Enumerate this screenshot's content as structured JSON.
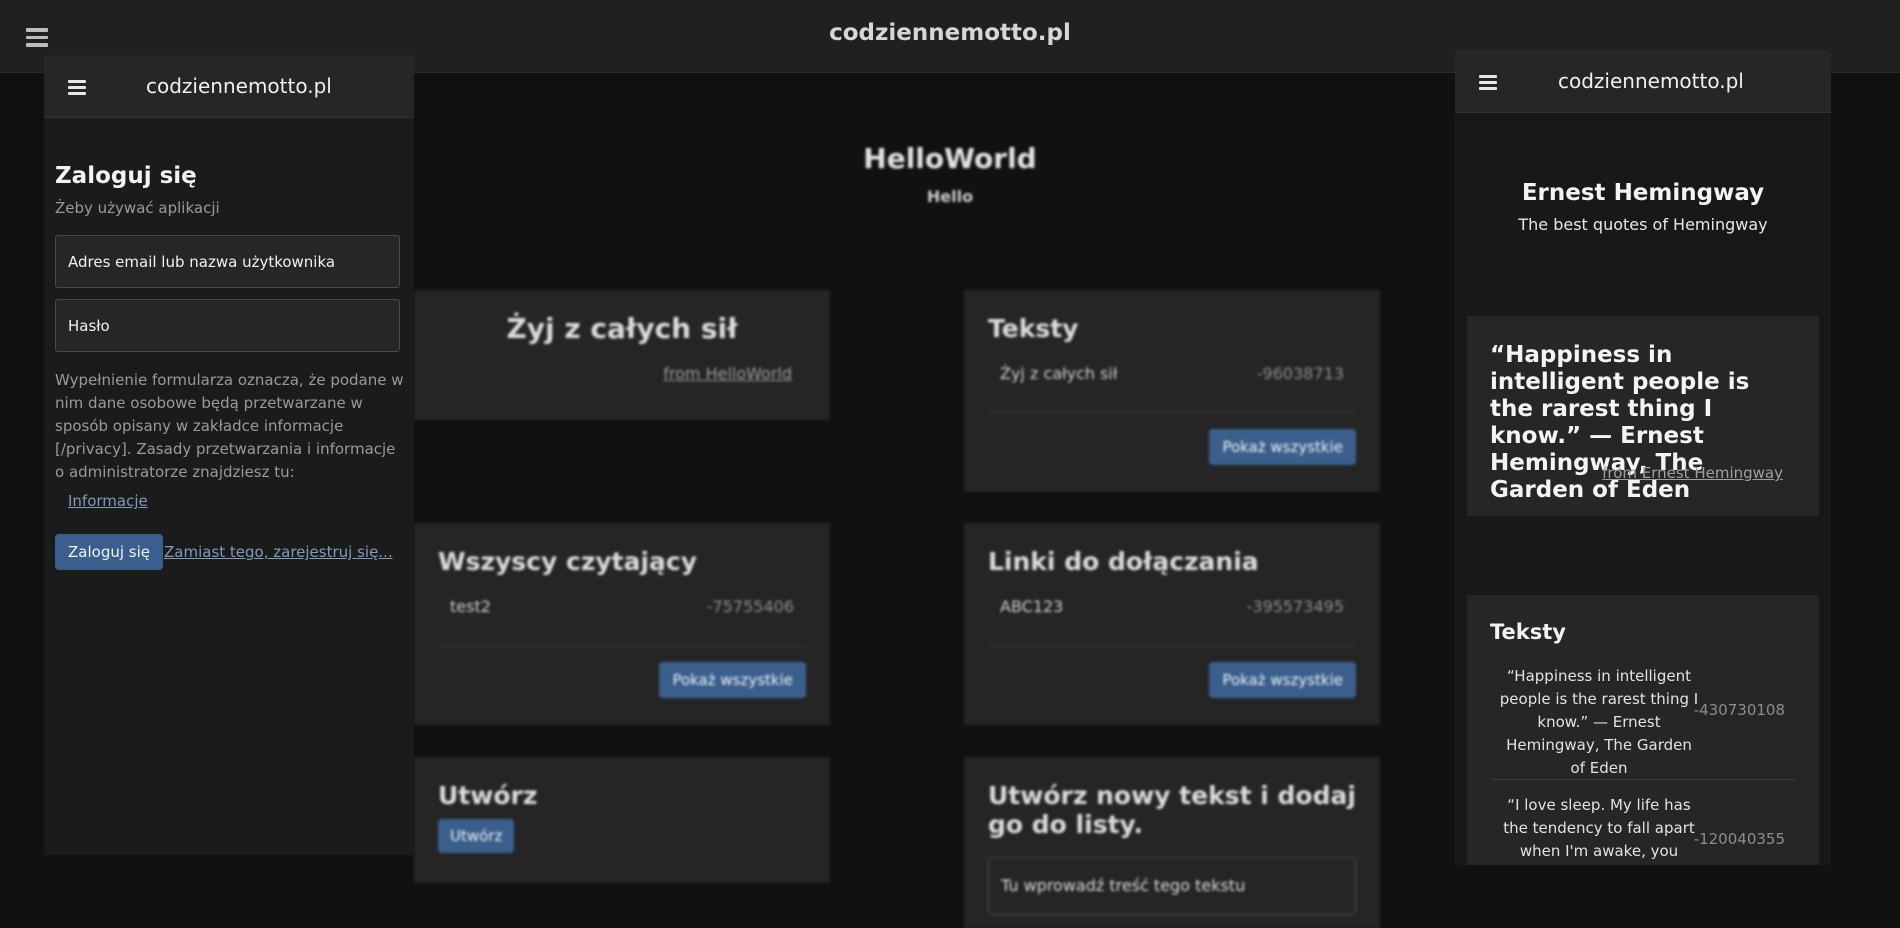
{
  "background": {
    "site_title": "codziennemotto.pl",
    "heading": "HelloWorld",
    "subheading": "Hello",
    "motto_card": {
      "title": "Żyj z całych sił",
      "from_link": "from HelloWorld"
    },
    "texts_card": {
      "title": "Teksty",
      "rows": [
        {
          "name": "Żyj z całych sił",
          "value": "-96038713"
        }
      ],
      "button": "Pokaż wszystkie"
    },
    "readers_card": {
      "title": "Wszyscy czytający",
      "rows": [
        {
          "name": "test2",
          "value": "-75755406"
        }
      ],
      "button": "Pokaż wszystkie"
    },
    "links_card": {
      "title": "Linki do dołączania",
      "rows": [
        {
          "name": "ABC123",
          "value": "-395573495"
        }
      ],
      "button": "Pokaż wszystkie"
    },
    "create_card": {
      "title": "Utwórz",
      "button": "Utwórz"
    },
    "new_text_card": {
      "title": "Utwórz nowy tekst i dodaj go do listy.",
      "placeholder": "Tu wprowadź treść tego tekstu"
    }
  },
  "left_panel": {
    "site_title": "codziennemotto.pl",
    "login_title": "Zaloguj się",
    "login_subtitle": "Żeby używać aplikacji",
    "email_placeholder": "Adres email lub nazwa użytkownika",
    "password_placeholder": "Hasło",
    "consent_text": "Wypełnienie formularza oznacza, że podane w nim dane osobowe będą przetwarzane w sposób opisany w zakładce informacje [/privacy]. Zasady przetwarzania i informacje o administratorze znajdziesz tu:",
    "info_link": "Informacje",
    "login_button": "Zaloguj się",
    "register_link": "Zamiast tego, zarejestruj się..."
  },
  "right_panel": {
    "site_title": "codziennemotto.pl",
    "author": "Ernest Hemingway",
    "author_subtitle": "The best quotes of Hemingway",
    "featured_quote": "“Happiness in intelligent people is the rarest thing I know.” — Ernest Hemingway, The Garden of Eden",
    "featured_from": "from Ernest Hemingway",
    "texts_title": "Teksty",
    "texts": [
      {
        "text": "“Happiness in intelligent people is the rarest thing I know.” — Ernest Hemingway, The Garden of Eden",
        "value": "-430730108"
      },
      {
        "text": "“I love sleep. My life has the tendency to fall apart when I'm awake, you know?” —",
        "value": "-120040355"
      }
    ]
  },
  "colors": {
    "accent_button": "#3a5f8c",
    "background": "#111111",
    "card": "#252525"
  }
}
